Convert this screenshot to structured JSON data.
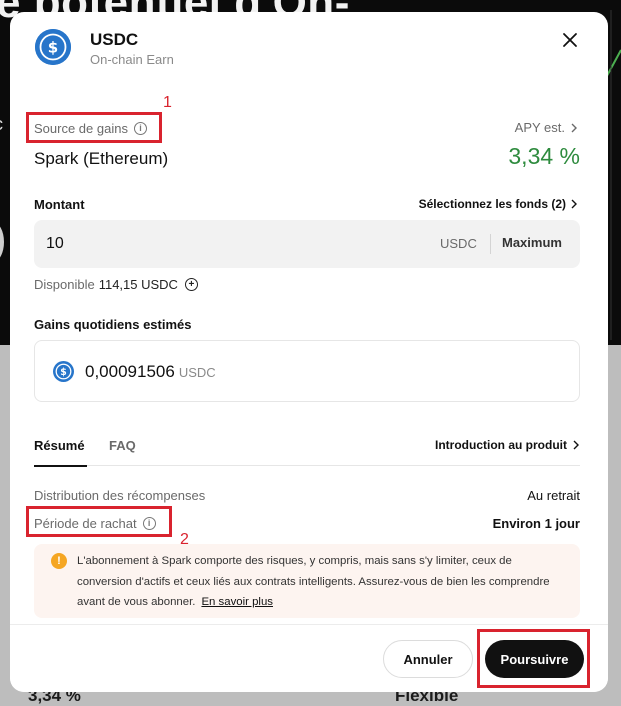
{
  "background": {
    "hero_text": "e potentiel d'On-",
    "left_fragment": "c",
    "bottom_left": "3,34 %",
    "bottom_right": "Flexible"
  },
  "modal": {
    "title": "USDC",
    "subtitle": "On-chain Earn",
    "close_icon": "close-icon"
  },
  "source": {
    "label": "Source de gains",
    "value": "Spark (Ethereum)",
    "apy_label": "APY est.",
    "apy_value": "3,34 %"
  },
  "amount": {
    "label": "Montant",
    "select_funds": "Sélectionnez les fonds (2)",
    "value": "10",
    "unit": "USDC",
    "max_label": "Maximum",
    "available_label": "Disponible",
    "available_value": "114,15 USDC"
  },
  "daily": {
    "label": "Gains quotidiens estimés",
    "value": "0,00091506",
    "unit": "USDC"
  },
  "tabs": {
    "items": [
      {
        "label": "Résumé"
      },
      {
        "label": "FAQ"
      }
    ],
    "intro_link": "Introduction au produit"
  },
  "details": {
    "distribution_label": "Distribution des récompenses",
    "distribution_value": "Au retrait",
    "redemption_label": "Période de rachat",
    "redemption_value": "Environ 1 jour"
  },
  "warning": {
    "text": "L'abonnement à Spark comporte des risques, y compris, mais sans s'y limiter, ceux de conversion d'actifs et ceux liés aux contrats intelligents. Assurez-vous de bien les comprendre avant de vous abonner.",
    "link": "En savoir plus"
  },
  "footer": {
    "cancel_label": "Annuler",
    "continue_label": "Poursuivre"
  },
  "annotations": {
    "one": "1",
    "two": "2"
  },
  "colors": {
    "accent_green": "#2e8b3e",
    "usdc_blue": "#2775ca",
    "annotation_red": "#d9232e",
    "warning_orange": "#f5a623"
  }
}
